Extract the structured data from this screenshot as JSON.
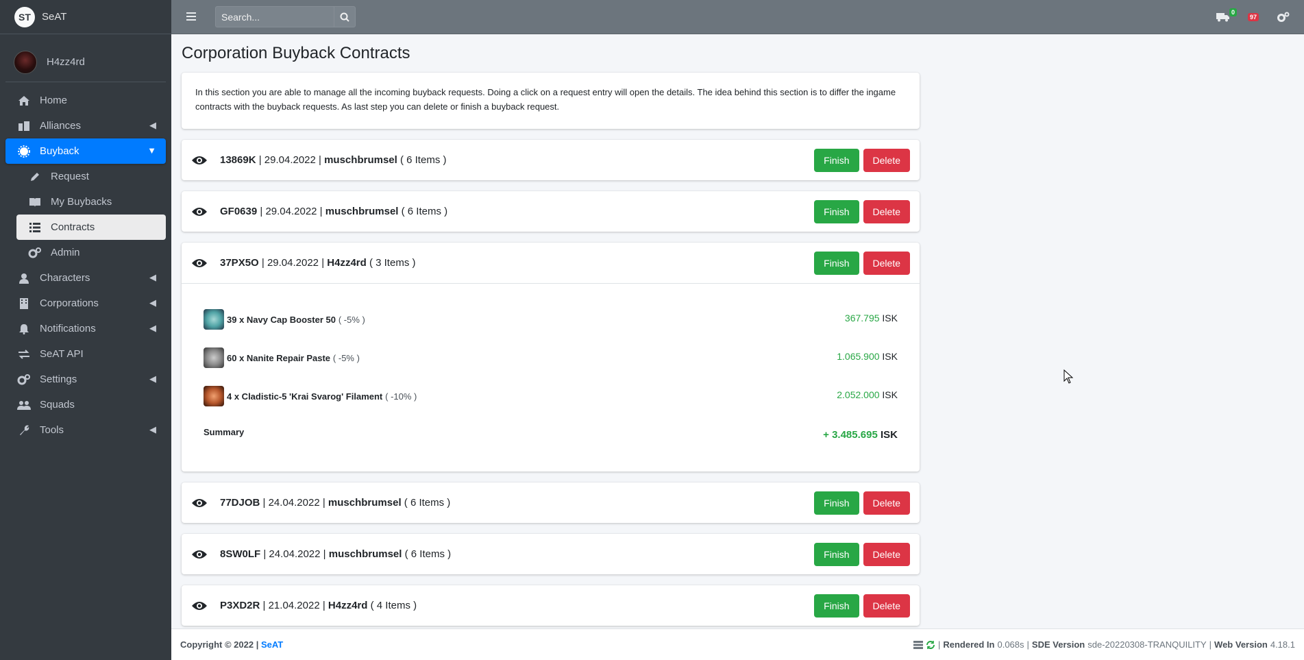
{
  "brand": {
    "logo": "ST",
    "name": "SeAT"
  },
  "user": {
    "name": "H4zz4rd"
  },
  "sidebar": {
    "items": [
      {
        "label": "Home",
        "icon": "home-icon"
      },
      {
        "label": "Alliances",
        "icon": "building-icon"
      },
      {
        "label": "Buyback",
        "icon": "gear-icon"
      },
      {
        "label": "Request",
        "icon": "pencil-icon"
      },
      {
        "label": "My Buybacks",
        "icon": "book-icon"
      },
      {
        "label": "Contracts",
        "icon": "list-icon"
      },
      {
        "label": "Admin",
        "icon": "cogs-icon"
      },
      {
        "label": "Characters",
        "icon": "user-icon"
      },
      {
        "label": "Corporations",
        "icon": "building-icon"
      },
      {
        "label": "Notifications",
        "icon": "bell-icon"
      },
      {
        "label": "SeAT API",
        "icon": "exchange-icon"
      },
      {
        "label": "Settings",
        "icon": "cogs-icon"
      },
      {
        "label": "Squads",
        "icon": "users-icon"
      },
      {
        "label": "Tools",
        "icon": "wrench-icon"
      }
    ]
  },
  "topbar": {
    "search_placeholder": "Search...",
    "badge_contracts": "0",
    "badge_notifications": "97"
  },
  "page": {
    "title": "Corporation Buyback Contracts",
    "intro": "In this section you are able to manage all the incoming buyback requests. Doing a click on a request entry will open the details. The idea behind this section is to differ the ingame contracts with the buyback requests. As last step you can delete or finish a buyback request."
  },
  "buttons": {
    "finish": "Finish",
    "delete": "Delete"
  },
  "contracts": [
    {
      "id": "13869K",
      "date": "29.04.2022",
      "owner": "muschbrumsel",
      "items": "( 6 Items )"
    },
    {
      "id": "GF0639",
      "date": "29.04.2022",
      "owner": "muschbrumsel",
      "items": "( 6 Items )"
    },
    {
      "id": "37PX5O",
      "date": "29.04.2022",
      "owner": "H4zz4rd",
      "items": "( 3 Items )"
    },
    {
      "id": "77DJOB",
      "date": "24.04.2022",
      "owner": "muschbrumsel",
      "items": "( 6 Items )"
    },
    {
      "id": "8SW0LF",
      "date": "24.04.2022",
      "owner": "muschbrumsel",
      "items": "( 6 Items )"
    },
    {
      "id": "P3XD2R",
      "date": "21.04.2022",
      "owner": "H4zz4rd",
      "items": "( 4 Items )"
    }
  ],
  "details": {
    "items": [
      {
        "name": "39 x Navy Cap Booster 50",
        "pct": "( -5% )",
        "price": "367.795",
        "currency": "ISK",
        "color": "#4fa3a5"
      },
      {
        "name": "60 x Nanite Repair Paste",
        "pct": "( -5% )",
        "price": "1.065.900",
        "currency": "ISK",
        "color": "#8a8a8a"
      },
      {
        "name": "4 x Cladistic-5 'Krai Svarog' Filament",
        "pct": "( -10% )",
        "price": "2.052.000",
        "currency": "ISK",
        "color": "#b5562b"
      }
    ],
    "summary_label": "Summary",
    "summary_value": "+ 3.485.695",
    "summary_currency": "ISK"
  },
  "footer": {
    "copyright": "Copyright © 2022 |",
    "link": "SeAT",
    "rendered_label": "Rendered In",
    "rendered_value": "0.068s",
    "sde_label": "SDE Version",
    "sde_value": "sde-20220308-TRANQUILITY",
    "web_label": "Web Version",
    "web_value": "4.18.1"
  }
}
